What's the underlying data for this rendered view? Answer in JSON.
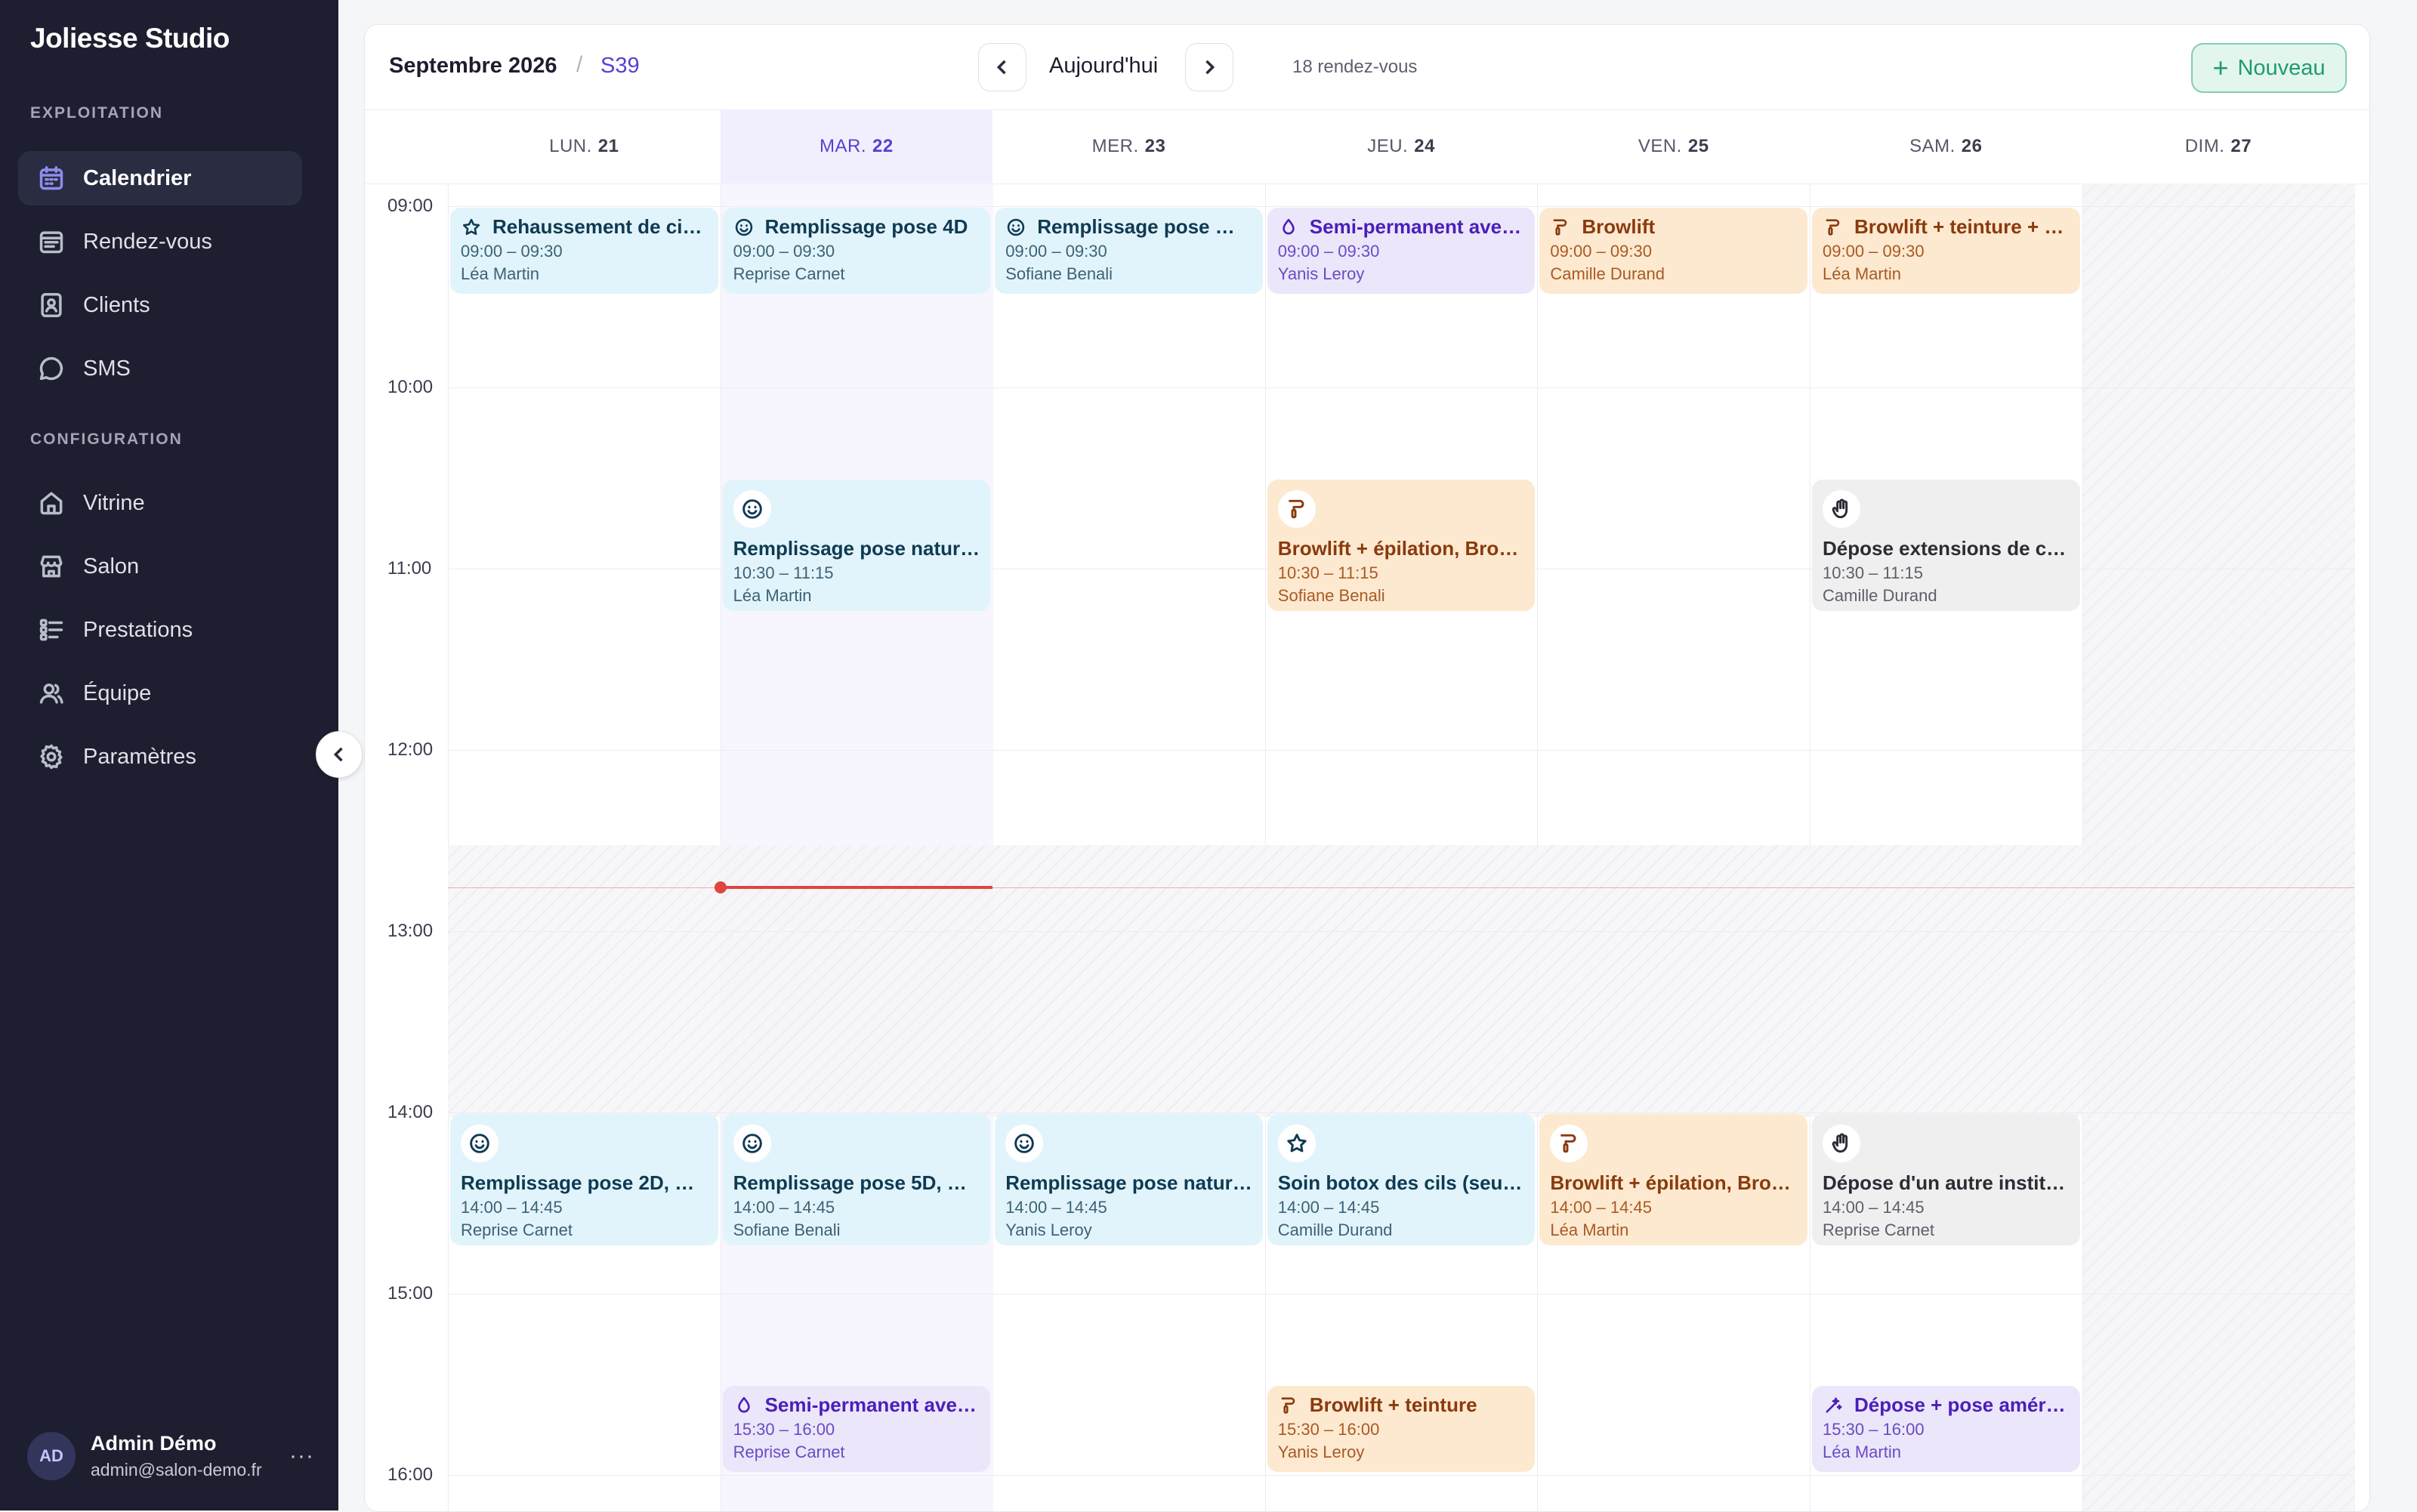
{
  "sidebar": {
    "brand": "Joliesse Studio",
    "section_exploitation": "EXPLOITATION",
    "section_configuration": "CONFIGURATION",
    "nav": [
      {
        "label": "Calendrier",
        "icon": "calendar-icon"
      },
      {
        "label": "Rendez-vous",
        "icon": "list-calendar-icon"
      },
      {
        "label": "Clients",
        "icon": "contact-card-icon"
      },
      {
        "label": "SMS",
        "icon": "chat-bubble-icon"
      }
    ],
    "config": [
      {
        "label": "Vitrine",
        "icon": "home-icon"
      },
      {
        "label": "Salon",
        "icon": "store-icon"
      },
      {
        "label": "Prestations",
        "icon": "checklist-icon"
      },
      {
        "label": "Équipe",
        "icon": "team-icon"
      },
      {
        "label": "Paramètres",
        "icon": "gear-icon"
      }
    ],
    "user": {
      "initials": "AD",
      "name": "Admin Démo",
      "email": "admin@salon-demo.fr",
      "more": "···"
    }
  },
  "toolbar": {
    "month": "Septembre 2026",
    "separator": "/",
    "week": "S39",
    "today": "Aujourd'hui",
    "count": "18 rendez-vous",
    "new_label": "Nouveau",
    "new_plus": "+"
  },
  "days": [
    {
      "name": "LUN.",
      "num": "21"
    },
    {
      "name": "MAR.",
      "num": "22"
    },
    {
      "name": "MER.",
      "num": "23"
    },
    {
      "name": "JEU.",
      "num": "24"
    },
    {
      "name": "VEN.",
      "num": "25"
    },
    {
      "name": "SAM.",
      "num": "26"
    },
    {
      "name": "DIM.",
      "num": "27"
    }
  ],
  "hours": [
    "09:00",
    "10:00",
    "11:00",
    "12:00",
    "13:00",
    "14:00",
    "15:00",
    "16:00"
  ],
  "events": [
    {
      "day": 0,
      "start": "09:00",
      "end": "09:30",
      "title": "Rehaussement de cils...",
      "time": "09:00 – 09:30",
      "who": "Léa Martin",
      "color": "blue",
      "icon": "star-icon"
    },
    {
      "day": 1,
      "start": "09:00",
      "end": "09:30",
      "title": "Remplissage pose 4D",
      "time": "09:00 – 09:30",
      "who": "Reprise Carnet",
      "color": "blue",
      "icon": "smiley-icon"
    },
    {
      "day": 2,
      "start": "09:00",
      "end": "09:30",
      "title": "Remplissage pose mi...",
      "time": "09:00 – 09:30",
      "who": "Sofiane Benali",
      "color": "blue",
      "icon": "smiley-icon"
    },
    {
      "day": 3,
      "start": "09:00",
      "end": "09:30",
      "title": "Semi-permanent avec...",
      "time": "09:00 – 09:30",
      "who": "Yanis Leroy",
      "color": "purple",
      "icon": "drop-icon"
    },
    {
      "day": 4,
      "start": "09:00",
      "end": "09:30",
      "title": "Browlift",
      "time": "09:00 – 09:30",
      "who": "Camille Durand",
      "color": "orange",
      "icon": "brush-icon"
    },
    {
      "day": 5,
      "start": "09:00",
      "end": "09:30",
      "title": "Browlift + teinture + é...",
      "time": "09:00 – 09:30",
      "who": "Léa Martin",
      "color": "orange",
      "icon": "brush-icon"
    },
    {
      "day": 1,
      "start": "10:30",
      "end": "11:15",
      "title": "Remplissage pose naturel...",
      "time": "10:30 – 11:15",
      "who": "Léa Martin",
      "color": "blue",
      "icon": "smiley-icon"
    },
    {
      "day": 3,
      "start": "10:30",
      "end": "11:15",
      "title": "Browlift + épilation, Browl...",
      "time": "10:30 – 11:15",
      "who": "Sofiane Benali",
      "color": "orange",
      "icon": "brush-icon"
    },
    {
      "day": 5,
      "start": "10:30",
      "end": "11:15",
      "title": "Dépose extensions de cils ...",
      "time": "10:30 – 11:15",
      "who": "Camille Durand",
      "color": "gray",
      "icon": "hand-icon"
    },
    {
      "day": 0,
      "start": "14:00",
      "end": "14:45",
      "title": "Remplissage pose 2D, Re...",
      "time": "14:00 – 14:45",
      "who": "Reprise Carnet",
      "color": "blue",
      "icon": "smiley-icon"
    },
    {
      "day": 1,
      "start": "14:00",
      "end": "14:45",
      "title": "Remplissage pose 5D, Re...",
      "time": "14:00 – 14:45",
      "who": "Sofiane Benali",
      "color": "blue",
      "icon": "smiley-icon"
    },
    {
      "day": 2,
      "start": "14:00",
      "end": "14:45",
      "title": "Remplissage pose naturel...",
      "time": "14:00 – 14:45",
      "who": "Yanis Leroy",
      "color": "blue",
      "icon": "smiley-icon"
    },
    {
      "day": 3,
      "start": "14:00",
      "end": "14:45",
      "title": "Soin botox des cils (seul), ...",
      "time": "14:00 – 14:45",
      "who": "Camille Durand",
      "color": "blue",
      "icon": "star-icon"
    },
    {
      "day": 4,
      "start": "14:00",
      "end": "14:45",
      "title": "Browlift + épilation, Browl...",
      "time": "14:00 – 14:45",
      "who": "Léa Martin",
      "color": "orange",
      "icon": "brush-icon"
    },
    {
      "day": 5,
      "start": "14:00",
      "end": "14:45",
      "title": "Dépose d'un autre institut,...",
      "time": "14:00 – 14:45",
      "who": "Reprise Carnet",
      "color": "gray",
      "icon": "hand-icon"
    },
    {
      "day": 1,
      "start": "15:30",
      "end": "16:00",
      "title": "Semi-permanent avec...",
      "time": "15:30 – 16:00",
      "who": "Reprise Carnet",
      "color": "purple",
      "icon": "drop-icon"
    },
    {
      "day": 3,
      "start": "15:30",
      "end": "16:00",
      "title": "Browlift + teinture",
      "time": "15:30 – 16:00",
      "who": "Yanis Leroy",
      "color": "orange",
      "icon": "brush-icon"
    },
    {
      "day": 5,
      "start": "15:30",
      "end": "16:00",
      "title": "Dépose + pose améric...",
      "time": "15:30 – 16:00",
      "who": "Léa Martin",
      "color": "purple",
      "icon": "sparkle-wand-icon"
    }
  ]
}
